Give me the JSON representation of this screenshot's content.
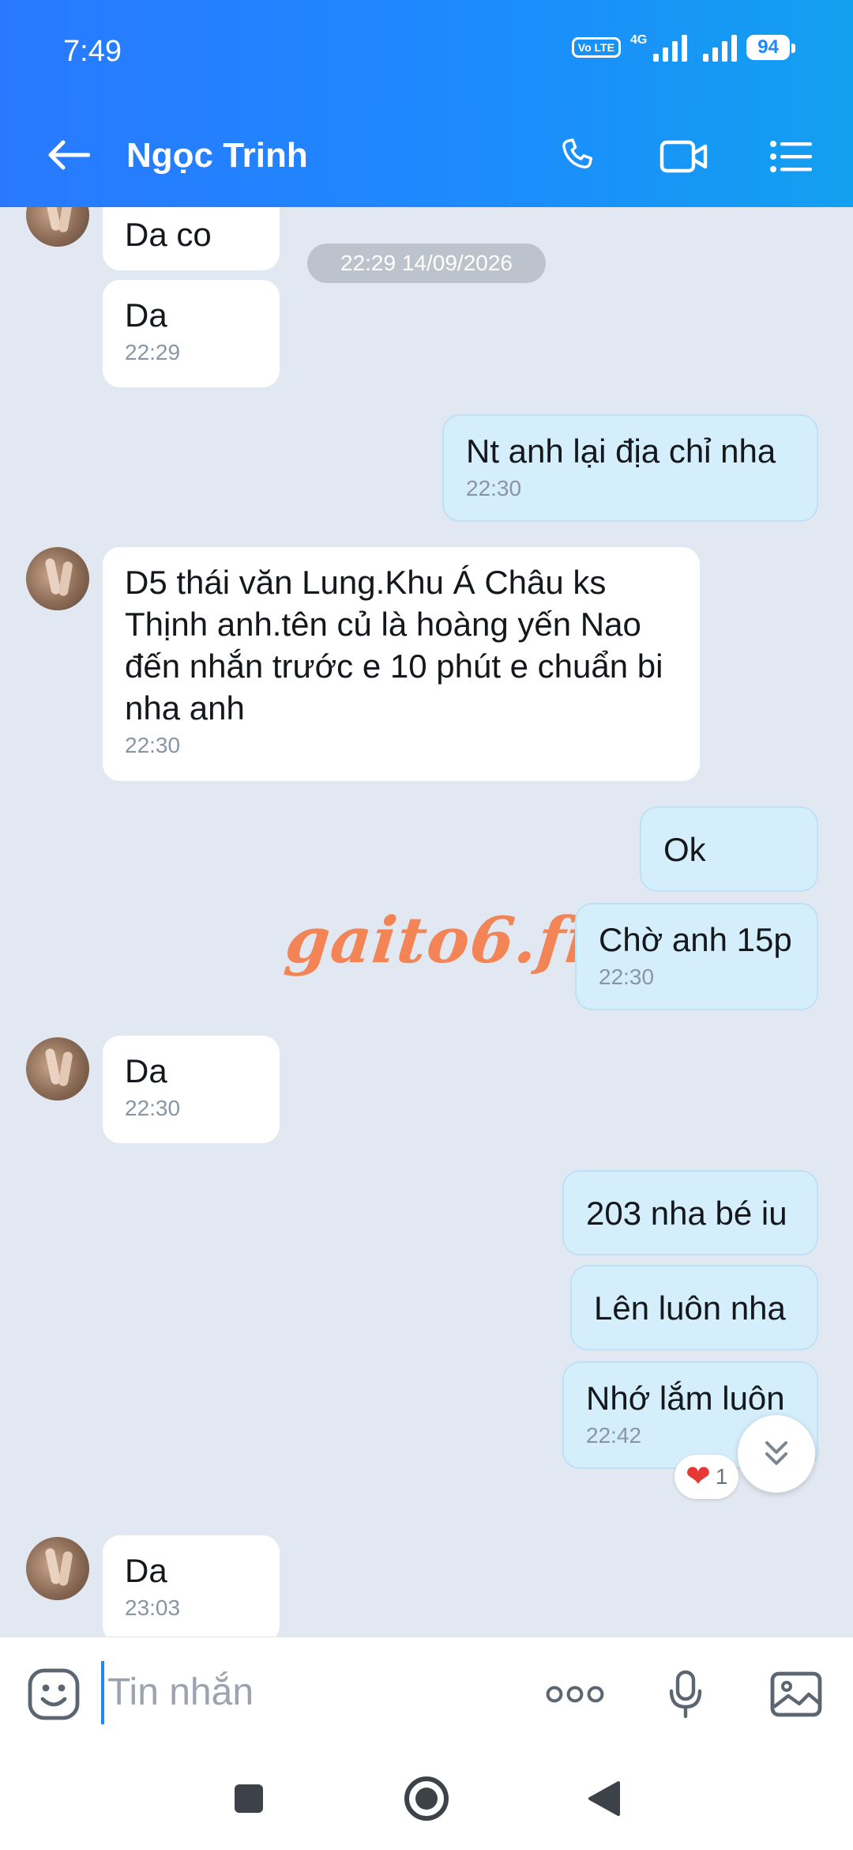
{
  "status_bar": {
    "time": "7:49",
    "volte_label": "Vo LTE",
    "network_label": "4G",
    "battery_level": "94"
  },
  "header": {
    "contact_name": "Ngọc Trinh",
    "icons": [
      "back-arrow-icon",
      "phone-icon",
      "video-call-icon",
      "menu-list-icon"
    ]
  },
  "chat": {
    "date_separator": "22:29 14/09/2026",
    "messages": [
      {
        "direction": "in",
        "text": "Da co",
        "time": ""
      },
      {
        "direction": "in",
        "text": "Da",
        "time": "22:29"
      },
      {
        "direction": "out",
        "text": "Nt anh lại địa chỉ nha",
        "time": "22:30"
      },
      {
        "direction": "in",
        "text": "D5 thái văn Lung.Khu Á Châu ks Thịnh anh.tên củ là hoàng yến Nao đến nhắn trước e 10 phút e chuẩn bi nha anh",
        "time": "22:30"
      },
      {
        "direction": "out",
        "text": "Ok",
        "time": ""
      },
      {
        "direction": "out",
        "text": "Chờ anh 15p",
        "time": "22:30"
      },
      {
        "direction": "in",
        "text": "Da",
        "time": "22:30"
      },
      {
        "direction": "out",
        "text": "203 nha bé iu",
        "time": ""
      },
      {
        "direction": "out",
        "text": "Lên luôn nha",
        "time": ""
      },
      {
        "direction": "out",
        "text": "Nhớ lắm luôn",
        "time": "22:42"
      },
      {
        "direction": "in",
        "text": "Da",
        "time": "23:03"
      }
    ],
    "reaction": {
      "emoji": "❤",
      "count": "1"
    },
    "watermark": "gaito6.fit"
  },
  "input_bar": {
    "placeholder": "Tin nhắn",
    "icons": [
      "sticker-icon",
      "more-icon",
      "microphone-icon",
      "image-icon"
    ]
  },
  "colors": {
    "header_gradient_start": "#2979ff",
    "header_gradient_end": "#12a0f0",
    "outgoing_bubble": "#d5eefc",
    "incoming_bubble": "#ffffff",
    "chat_background": "#e2e8f1",
    "watermark": "#f28456"
  }
}
